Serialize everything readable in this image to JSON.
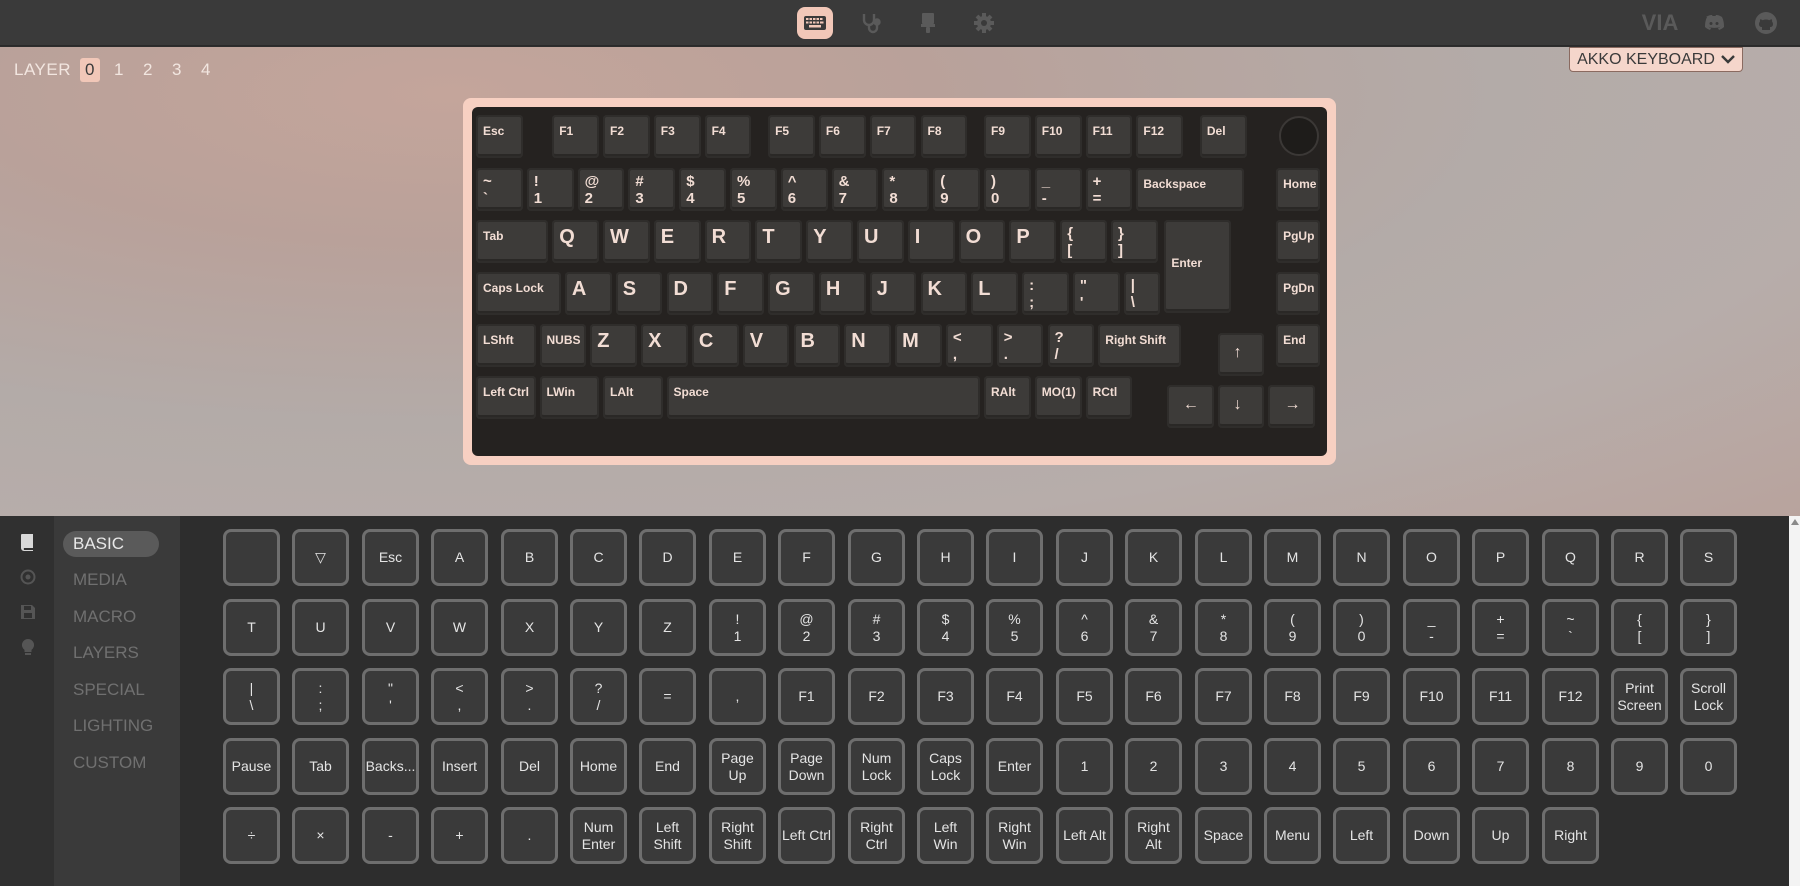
{
  "topbar": {
    "nav": [
      {
        "name": "configure-keyboard-icon",
        "active": true
      },
      {
        "name": "test-stethoscope-icon",
        "active": false
      },
      {
        "name": "design-brush-icon",
        "active": false
      },
      {
        "name": "settings-gear-icon",
        "active": false
      }
    ],
    "via_logo": "VIA"
  },
  "layer": {
    "label": "LAYER",
    "options": [
      "0",
      "1",
      "2",
      "3",
      "4"
    ],
    "selected": "0"
  },
  "keyboard_select": {
    "value": "AKKO KEYBOARD"
  },
  "keyboard": {
    "rows": [
      [
        {
          "t": "Esc"
        },
        {
          "t": "F1"
        },
        {
          "t": "F2"
        },
        {
          "t": "F3"
        },
        {
          "t": "F4"
        },
        {
          "t": "F5"
        },
        {
          "t": "F6"
        },
        {
          "t": "F7"
        },
        {
          "t": "F8"
        },
        {
          "t": "F9"
        },
        {
          "t": "F10"
        },
        {
          "t": "F11"
        },
        {
          "t": "F12"
        },
        {
          "t": "Del"
        }
      ],
      [
        {
          "t": "~\n`"
        },
        {
          "t": "!\n1"
        },
        {
          "t": "@\n2"
        },
        {
          "t": "#\n3"
        },
        {
          "t": "$\n4"
        },
        {
          "t": "%\n5"
        },
        {
          "t": "^\n6"
        },
        {
          "t": "&\n7"
        },
        {
          "t": "*\n8"
        },
        {
          "t": "(\n9"
        },
        {
          "t": ")\n0"
        },
        {
          "t": "_\n-"
        },
        {
          "t": "+\n="
        },
        {
          "t": "Backspace"
        },
        {
          "t": "Home"
        }
      ],
      [
        {
          "t": "Tab"
        },
        {
          "t": "Q"
        },
        {
          "t": "W"
        },
        {
          "t": "E"
        },
        {
          "t": "R"
        },
        {
          "t": "T"
        },
        {
          "t": "Y"
        },
        {
          "t": "U"
        },
        {
          "t": "I"
        },
        {
          "t": "O"
        },
        {
          "t": "P"
        },
        {
          "t": "{\n["
        },
        {
          "t": "}\n]"
        },
        {
          "t": "Enter"
        },
        {
          "t": "PgUp"
        }
      ],
      [
        {
          "t": "Caps Lock"
        },
        {
          "t": "A"
        },
        {
          "t": "S"
        },
        {
          "t": "D"
        },
        {
          "t": "F"
        },
        {
          "t": "G"
        },
        {
          "t": "H"
        },
        {
          "t": "J"
        },
        {
          "t": "K"
        },
        {
          "t": "L"
        },
        {
          "t": ":\n;"
        },
        {
          "t": "\"\n'"
        },
        {
          "t": "|\n\\"
        },
        {
          "t": "PgDn"
        }
      ],
      [
        {
          "t": "LShft"
        },
        {
          "t": "NUBS"
        },
        {
          "t": "Z"
        },
        {
          "t": "X"
        },
        {
          "t": "C"
        },
        {
          "t": "V"
        },
        {
          "t": "B"
        },
        {
          "t": "N"
        },
        {
          "t": "M"
        },
        {
          "t": "<\n,"
        },
        {
          "t": ">\n."
        },
        {
          "t": "?\n/"
        },
        {
          "t": "Right Shift"
        },
        {
          "t": "↑"
        },
        {
          "t": "End"
        }
      ],
      [
        {
          "t": "Left Ctrl"
        },
        {
          "t": "LWin"
        },
        {
          "t": "LAlt"
        },
        {
          "t": "Space"
        },
        {
          "t": "RAlt"
        },
        {
          "t": "MO(1)"
        },
        {
          "t": "RCtl"
        },
        {
          "t": "←"
        },
        {
          "t": "↓"
        },
        {
          "t": "→"
        }
      ]
    ]
  },
  "rail": [
    "book-icon",
    "circle-dot-icon",
    "save-icon",
    "bulb-icon"
  ],
  "categories": [
    "BASIC",
    "MEDIA",
    "MACRO",
    "LAYERS",
    "SPECIAL",
    "LIGHTING",
    "CUSTOM"
  ],
  "active_category": "BASIC",
  "basic_keys": [
    [
      "",
      "▽",
      "Esc",
      "A",
      "B",
      "C",
      "D",
      "E",
      "F",
      "G",
      "H",
      "I",
      "J",
      "K",
      "L",
      "M",
      "N",
      "O",
      "P",
      "Q",
      "R",
      "S"
    ],
    [
      "T",
      "U",
      "V",
      "W",
      "X",
      "Y",
      "Z",
      "!\n1",
      "@\n2",
      "#\n3",
      "$\n4",
      "%\n5",
      "^\n6",
      "&\n7",
      "*\n8",
      "(\n9",
      ")\n0",
      "_\n-",
      "+\n=",
      "~\n`",
      "{\n[",
      "}\n]"
    ],
    [
      "|\n\\",
      ":\n;",
      "\"\n'",
      "<\n,",
      ">\n.",
      "?\n/",
      "=",
      ",",
      "F1",
      "F2",
      "F3",
      "F4",
      "F5",
      "F6",
      "F7",
      "F8",
      "F9",
      "F10",
      "F11",
      "F12",
      "Print\nScreen",
      "Scroll\nLock"
    ],
    [
      "Pause",
      "Tab",
      "Backs...",
      "Insert",
      "Del",
      "Home",
      "End",
      "Page\nUp",
      "Page\nDown",
      "Num\nLock",
      "Caps\nLock",
      "Enter",
      "1",
      "2",
      "3",
      "4",
      "5",
      "6",
      "7",
      "8",
      "9",
      "0"
    ],
    [
      "÷",
      "×",
      "-",
      "+",
      ".",
      "Num\nEnter",
      "Left\nShift",
      "Right\nShift",
      "Left Ctrl",
      "Right\nCtrl",
      "Left\nWin",
      "Right\nWin",
      "Left Alt",
      "Right\nAlt",
      "Space",
      "Menu",
      "Left",
      "Down",
      "Up",
      "Right"
    ]
  ],
  "colors": {
    "accent": "#f1c7b8",
    "topbar": "#3a3a3a",
    "panel": "#2d2d2d",
    "keycap": "#3d3b39",
    "legend": "#f2ddd4"
  }
}
